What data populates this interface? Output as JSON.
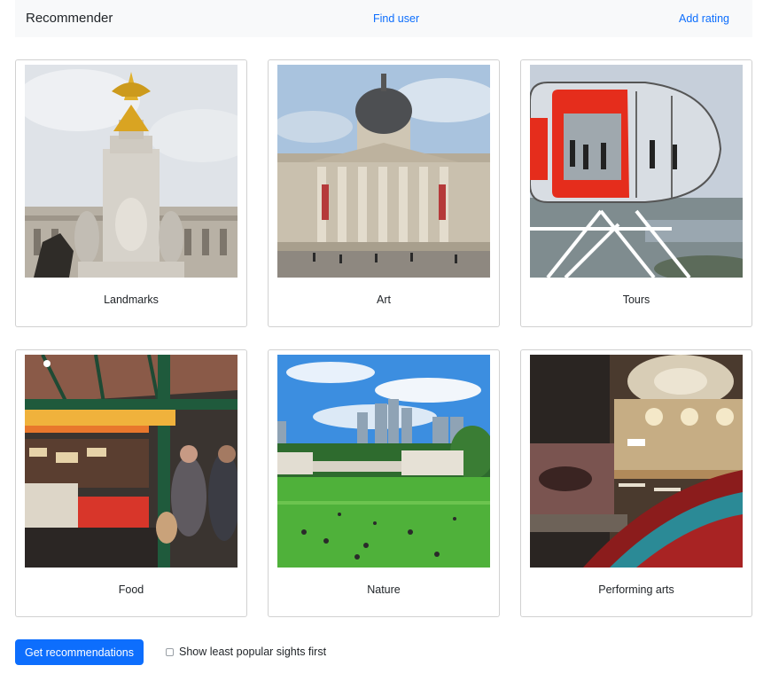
{
  "navbar": {
    "brand": "Recommender",
    "find_user": "Find user",
    "add_rating": "Add rating"
  },
  "categories": [
    {
      "label": "Landmarks",
      "image": "statue-monument-image"
    },
    {
      "label": "Art",
      "image": "gallery-building-image"
    },
    {
      "label": "Tours",
      "image": "observation-capsule-image"
    },
    {
      "label": "Food",
      "image": "market-stalls-image"
    },
    {
      "label": "Nature",
      "image": "park-skyline-image"
    },
    {
      "label": "Performing arts",
      "image": "theatre-interior-image"
    }
  ],
  "actions": {
    "get_recommendations": "Get recommendations",
    "least_popular_label": "Show least popular sights first",
    "least_popular_checked": false
  },
  "colors": {
    "primary": "#0d6efd",
    "navbar_bg": "#f8f9fa"
  }
}
